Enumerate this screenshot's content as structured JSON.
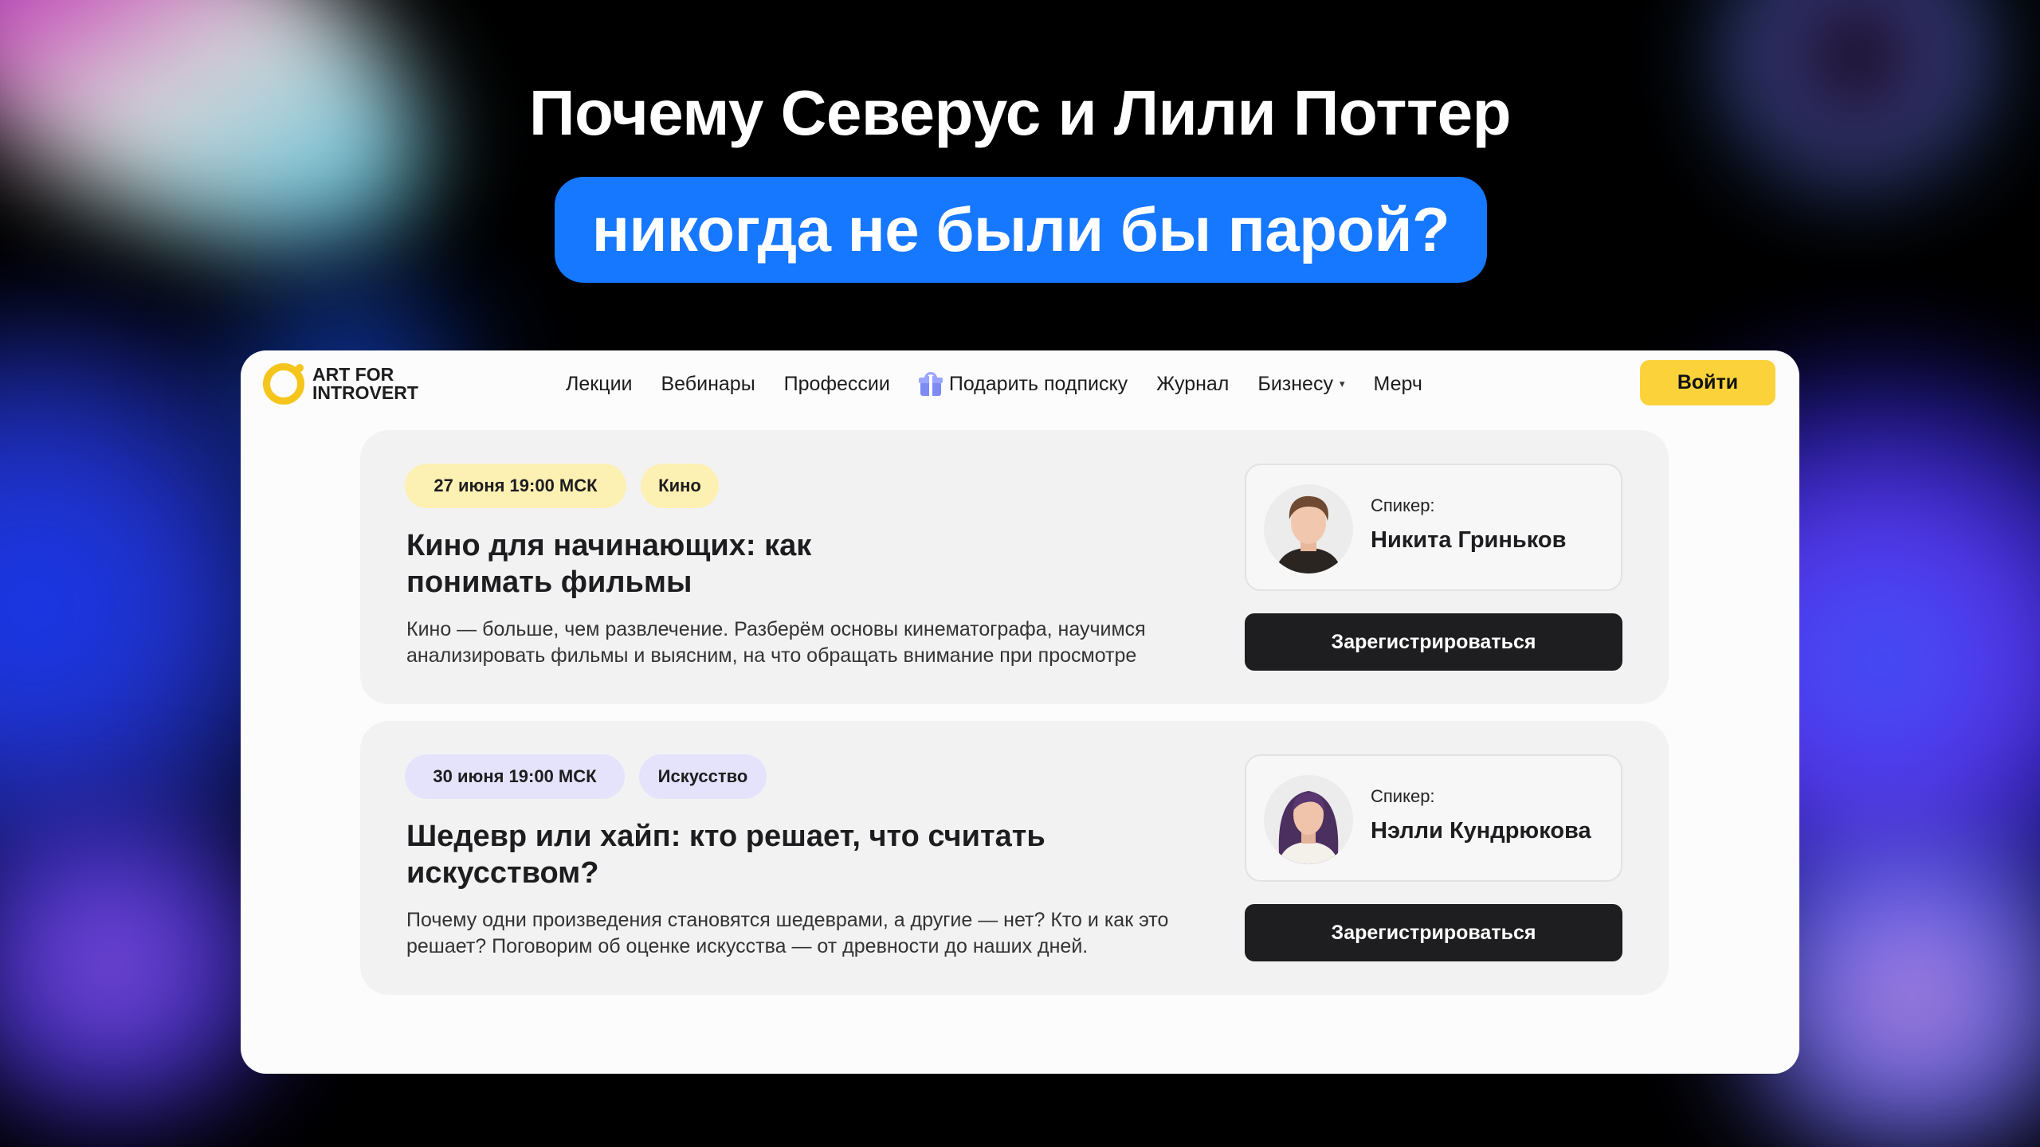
{
  "promo": {
    "headline_line1": "Почему Северус и Лили Поттер",
    "headline_line2": "никогда не были бы парой?",
    "pill_color": "#1677ff"
  },
  "header": {
    "logo_line1": "ART FOR",
    "logo_line2": "INTROVERT",
    "nav": [
      {
        "label": "Лекции"
      },
      {
        "label": "Вебинары"
      },
      {
        "label": "Профессии"
      },
      {
        "label": "Подарить подписку",
        "icon": "gift-icon"
      },
      {
        "label": "Журнал"
      },
      {
        "label": "Бизнесу",
        "has_dropdown": true,
        "caret": "▾"
      },
      {
        "label": "Мерч"
      }
    ],
    "login_label": "Войти",
    "accent_color": "#fbd23a"
  },
  "events": [
    {
      "date_tag": "27 июня 19:00 МСК",
      "date_tag_color": "#fdf0b3",
      "category_tag": "Кино",
      "category_tag_color": "#fdf0b3",
      "title": "Кино для начинающих: как понимать фильмы",
      "description": "Кино — больше, чем развлечение. Разберём основы кинематографа, научимся анализировать фильмы и выясним, на что обращать внимание при просмотре",
      "speaker_label": "Спикер:",
      "speaker_name": "Никита Гриньков",
      "register_label": "Зарегистрироваться"
    },
    {
      "date_tag": "30 июня 19:00 МСК",
      "date_tag_color": "#e5e3fb",
      "category_tag": "Искусство",
      "category_tag_color": "#e5e3fb",
      "title": "Шедевр или хайп: кто решает, что считать искусством?",
      "description": "Почему одни произведения становятся шедеврами, а другие — нет? Кто и как это решает? Поговорим об оценке искусства — от древности до наших дней.",
      "speaker_label": "Спикер:",
      "speaker_name": "Нэлли Кундрюкова",
      "register_label": "Зарегистрироваться"
    }
  ]
}
